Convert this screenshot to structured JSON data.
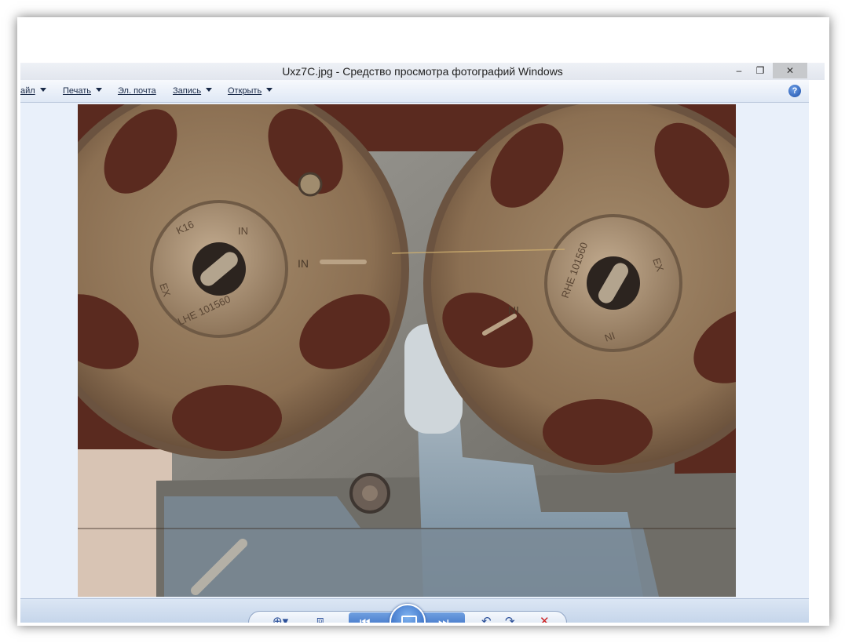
{
  "window": {
    "title": "Uxz7C.jpg - Средство просмотра фотографий Windows",
    "minimize_glyph": "–",
    "maximize_glyph": "❐",
    "close_glyph": "✕"
  },
  "menu": {
    "items": [
      {
        "label": "айл"
      },
      {
        "label": "Печать"
      },
      {
        "label": "Эл. почта"
      },
      {
        "label": "Запись"
      },
      {
        "label": "Открыть"
      }
    ],
    "help_glyph": "?"
  },
  "photo": {
    "left_gear_text": [
      "K16",
      "IN",
      "EX",
      "LHE 101560"
    ],
    "left_gear_mark": "IN",
    "right_gear_text": [
      "RHE 101560",
      "EX",
      "IN"
    ],
    "right_gear_mark": "IN"
  },
  "toolbar": {
    "zoom_icon": "zoom-icon",
    "fit_icon": "fit-icon",
    "prev_icon": "previous-icon",
    "slideshow_icon": "slideshow-icon",
    "next_icon": "next-icon",
    "rotate_ccw_icon": "rotate-left-icon",
    "rotate_cw_icon": "rotate-right-icon",
    "delete_icon": "delete-icon"
  },
  "colors": {
    "accent": "#2c63bd",
    "delete": "#cc2222"
  }
}
